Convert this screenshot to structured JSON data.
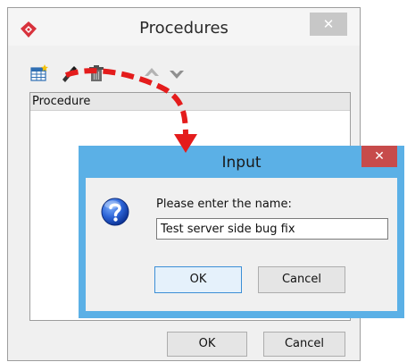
{
  "procedures_window": {
    "title": "Procedures",
    "close_glyph": "✕",
    "toolbar": [
      {
        "icon": "new-procedure-icon"
      },
      {
        "icon": "edit-icon"
      },
      {
        "icon": "delete-icon"
      },
      {
        "icon": "move-up-icon"
      },
      {
        "icon": "move-down-icon"
      }
    ],
    "list": {
      "column_header": "Procedure",
      "items": []
    },
    "ok_label": "OK",
    "cancel_label": "Cancel"
  },
  "input_dialog": {
    "title": "Input",
    "close_glyph": "✕",
    "prompt": "Please enter the name:",
    "value": "Test server side bug fix",
    "icon": "question-icon",
    "ok_label": "OK",
    "cancel_label": "Cancel"
  },
  "colors": {
    "accent_blue": "#5bb0e6",
    "close_red": "#c74b4b",
    "arrow_red": "#e41c1c",
    "logo_red": "#d8323c"
  }
}
